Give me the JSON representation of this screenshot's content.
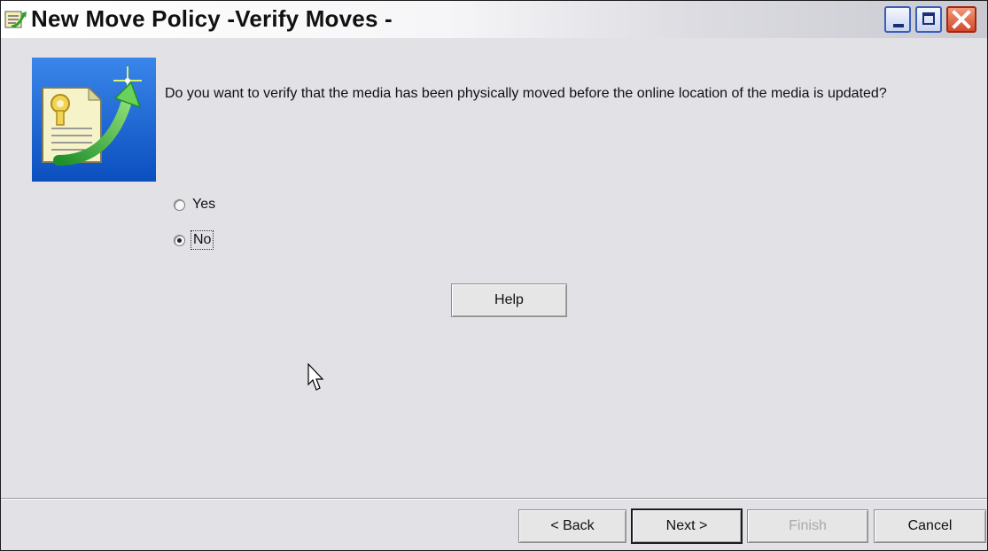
{
  "window": {
    "title": "New Move Policy -Verify Moves -",
    "controls": [
      "minimize-icon",
      "maximize-icon",
      "close-icon"
    ]
  },
  "wizard": {
    "image_icon": "document-key-arrow-icon",
    "question": "Do you want to verify that the media has been physically moved before the online location of the media is updated?",
    "options": [
      {
        "label": "Yes",
        "selected": false
      },
      {
        "label": "No",
        "selected": true
      }
    ],
    "help_label": "Help"
  },
  "footer": {
    "back_label": "< Back",
    "next_label": "Next >",
    "finish_label": "Finish",
    "cancel_label": "Cancel",
    "finish_enabled": false
  },
  "colors": {
    "dialog_background": "#e2e1e5",
    "close_button": "#d4472b",
    "disabled_text": "#a9a9a9"
  }
}
